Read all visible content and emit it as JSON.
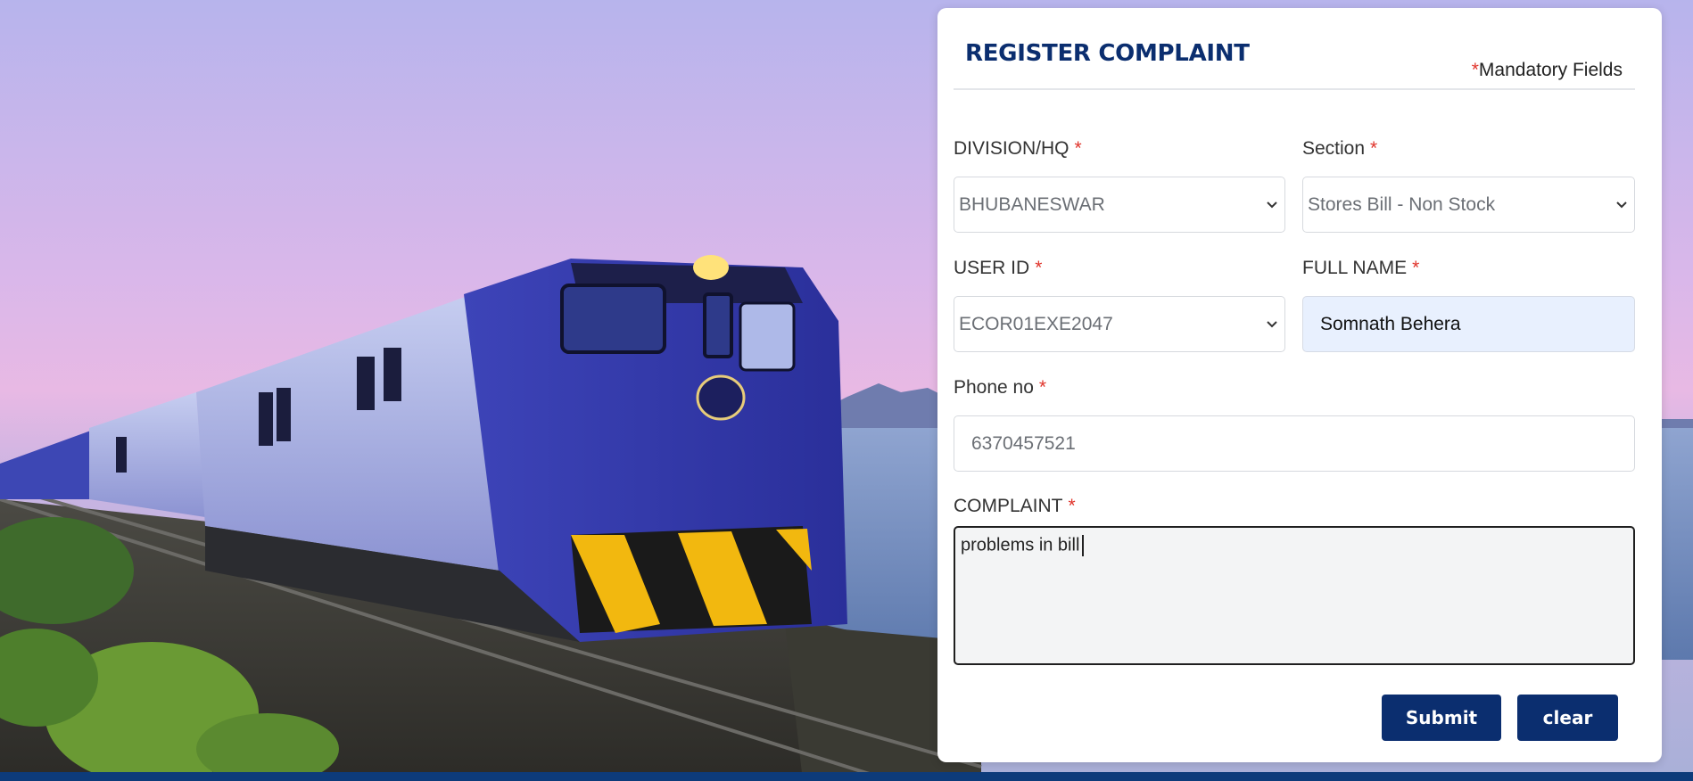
{
  "form": {
    "title": "REGISTER COMPLAINT",
    "mandatory_marker": "*",
    "mandatory_text": "Mandatory Fields",
    "required_marker": "*",
    "division": {
      "label": "DIVISION/HQ",
      "value": "BHUBANESWAR"
    },
    "section": {
      "label": "Section",
      "value": "Stores Bill - Non Stock"
    },
    "user_id": {
      "label": "USER ID",
      "value": "ECOR01EXE2047"
    },
    "full_name": {
      "label": "FULL NAME",
      "value": "Somnath Behera"
    },
    "phone": {
      "label": "Phone no",
      "value": "6370457521"
    },
    "complaint": {
      "label": "COMPLAINT",
      "value": "problems in bill"
    },
    "submit_label": "Submit",
    "clear_label": "clear"
  },
  "colors": {
    "brand": "#0b2e6f",
    "required": "#e0342b",
    "autofill_bg": "#e8f0fe",
    "footer_strip": "#0d3b7a"
  },
  "icons": [
    "chevron-down-icon"
  ]
}
